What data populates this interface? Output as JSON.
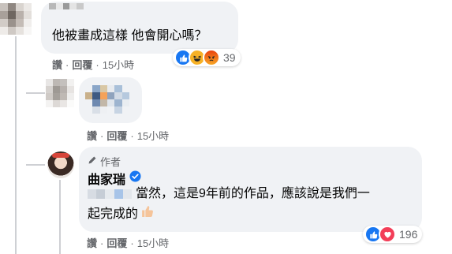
{
  "comments": [
    {
      "text": "他被畫成這樣 他會開心嗎？",
      "actions": {
        "like": "讚",
        "reply": "回覆",
        "time": "15小時"
      },
      "reactions": {
        "count": "39",
        "types": [
          "like-icon",
          "haha-icon",
          "angry-icon"
        ]
      }
    },
    {
      "actions": {
        "like": "讚",
        "reply": "回覆",
        "time": "15小時"
      }
    },
    {
      "author_tag": "作者",
      "author_name": "曲家瑞",
      "text_line1": "當然，這是9年前的作品，應該說是我們一",
      "text_line2": "起完成的",
      "actions": {
        "like": "讚",
        "reply": "回覆",
        "time": "15小時"
      },
      "reactions": {
        "count": "196",
        "types": [
          "like-icon",
          "love-icon"
        ]
      }
    }
  ],
  "separator": "·",
  "colors": {
    "like": "#1877f2",
    "love": "#f33e58",
    "haha": "#f7b125",
    "angry": "#e9710f",
    "verified": "#1877f2"
  }
}
